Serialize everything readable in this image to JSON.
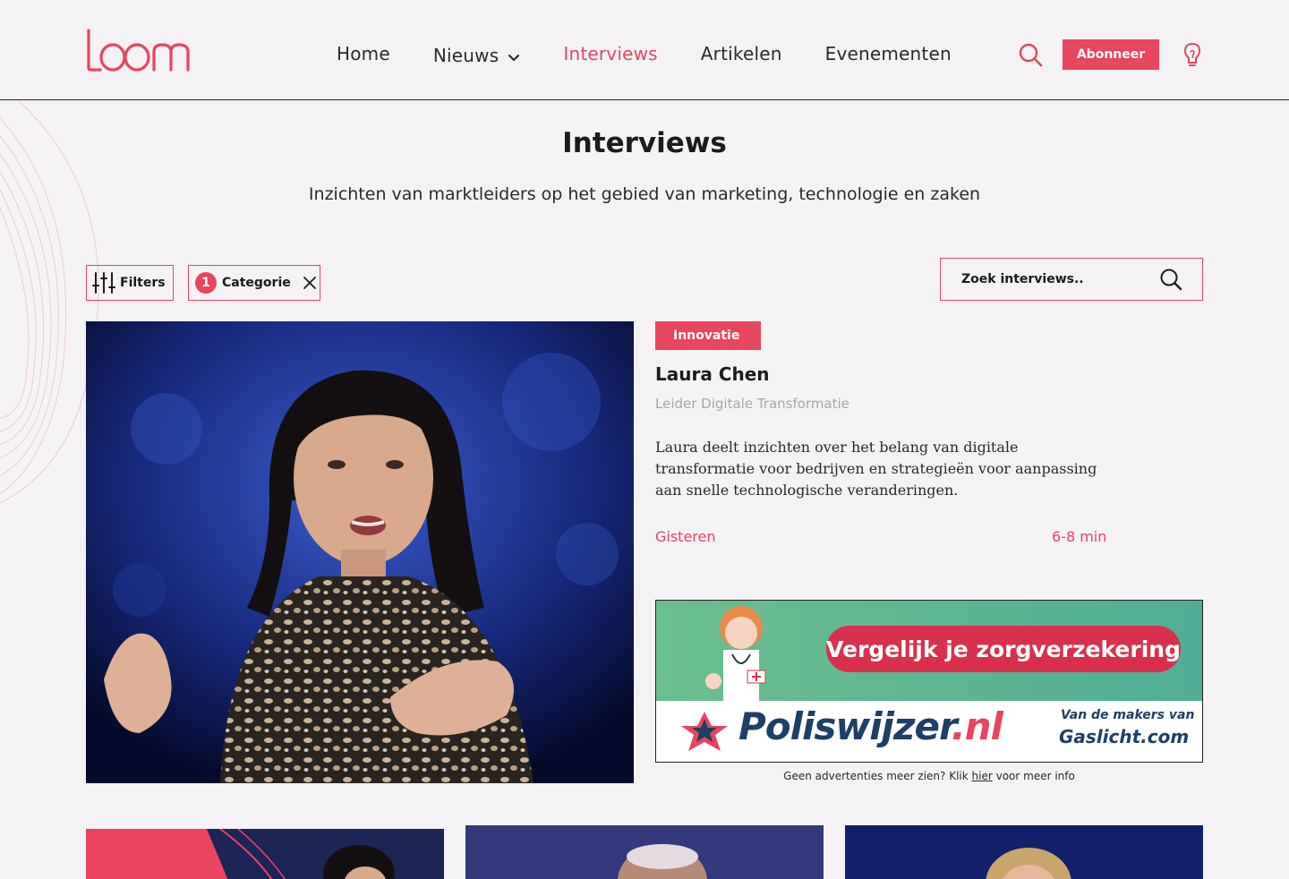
{
  "header": {
    "logo_text": "Loom",
    "nav": [
      {
        "label": "Home",
        "active": false,
        "dropdown": false
      },
      {
        "label": "Nieuws",
        "active": false,
        "dropdown": true
      },
      {
        "label": "Interviews",
        "active": true,
        "dropdown": false
      },
      {
        "label": "Artikelen",
        "active": false,
        "dropdown": false
      },
      {
        "label": "Evenementen",
        "active": false,
        "dropdown": false
      }
    ],
    "subscribe_label": "Abonneer",
    "icons": [
      "search-icon",
      "lightbulb-icon"
    ]
  },
  "hero": {
    "title": "Interviews",
    "subtitle": "Inzichten van marktleiders op het gebied van marketing, technologie en zaken"
  },
  "filters": {
    "filters_label": "Filters",
    "category_count": "1",
    "category_label": "Categorie",
    "search_placeholder": "Zoek interviews.."
  },
  "featured": {
    "tag": "Innovatie",
    "name": "Laura Chen",
    "role": "Leider Digitale Transformatie",
    "excerpt": "Laura deelt inzichten over het belang van digitale transformatie voor bedrijven en strategieën voor aanpassing aan snelle technologische veranderingen.",
    "date": "Gisteren",
    "read_time": "6-8 min"
  },
  "ad": {
    "headline": "Vergelijk je zorgverzekering",
    "brand_main": "Poliswijzer",
    "brand_tld": ".nl",
    "makers_line": "Van de makers van",
    "makers_brand": "Gaslicht.com",
    "note_prefix": "Geen advertenties meer zien? Klik ",
    "note_link": "hier",
    "note_suffix": " voor meer info"
  },
  "colors": {
    "accent": "#e8455f",
    "background": "#f4f2f5",
    "text": "#1b1b1b",
    "muted": "#a8a6a9"
  }
}
